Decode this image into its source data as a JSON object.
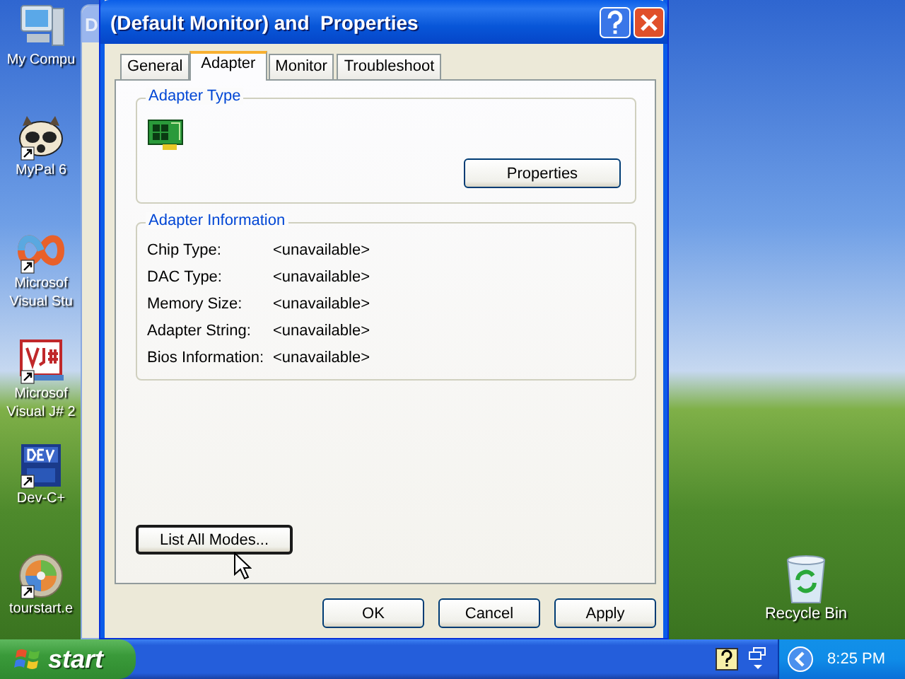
{
  "desktop_icons": [
    {
      "kind": "computer",
      "lines": [
        "My Compu"
      ]
    },
    {
      "kind": "raccoon",
      "lines": [
        "MyPal 6"
      ]
    },
    {
      "kind": "infinity",
      "lines": [
        "Microsof",
        "Visual Stu"
      ]
    },
    {
      "kind": "vjsharp",
      "lines": [
        "Microsof",
        "Visual J# 2"
      ]
    },
    {
      "kind": "dev",
      "lines": [
        "Dev-C+"
      ]
    },
    {
      "kind": "disc",
      "lines": [
        "tourstart.e"
      ]
    }
  ],
  "recycle_bin": {
    "label": "Recycle Bin"
  },
  "background_window": {
    "title": "D"
  },
  "dialog": {
    "title": "(Default Monitor) and  Properties",
    "tabs": [
      {
        "label": "General",
        "selected": false
      },
      {
        "label": "Adapter",
        "selected": true
      },
      {
        "label": "Monitor",
        "selected": false
      },
      {
        "label": "Troubleshoot",
        "selected": false
      }
    ],
    "adapter_type": {
      "title": "Adapter Type",
      "button": "Properties"
    },
    "adapter_information": {
      "title": "Adapter Information",
      "rows": [
        {
          "label": "Chip Type:",
          "value": "<unavailable>"
        },
        {
          "label": "DAC Type:",
          "value": "<unavailable>"
        },
        {
          "label": "Memory Size:",
          "value": "<unavailable>"
        },
        {
          "label": "Adapter String:",
          "value": "<unavailable>"
        },
        {
          "label": "Bios Information:",
          "value": "<unavailable>"
        }
      ]
    },
    "list_modes_button": {
      "label": "List All Modes...",
      "focused": true
    },
    "buttons": [
      {
        "label": "OK"
      },
      {
        "label": "Cancel"
      },
      {
        "label": "Apply"
      }
    ]
  },
  "taskbar": {
    "start": "start",
    "clock": "8:25 PM"
  }
}
